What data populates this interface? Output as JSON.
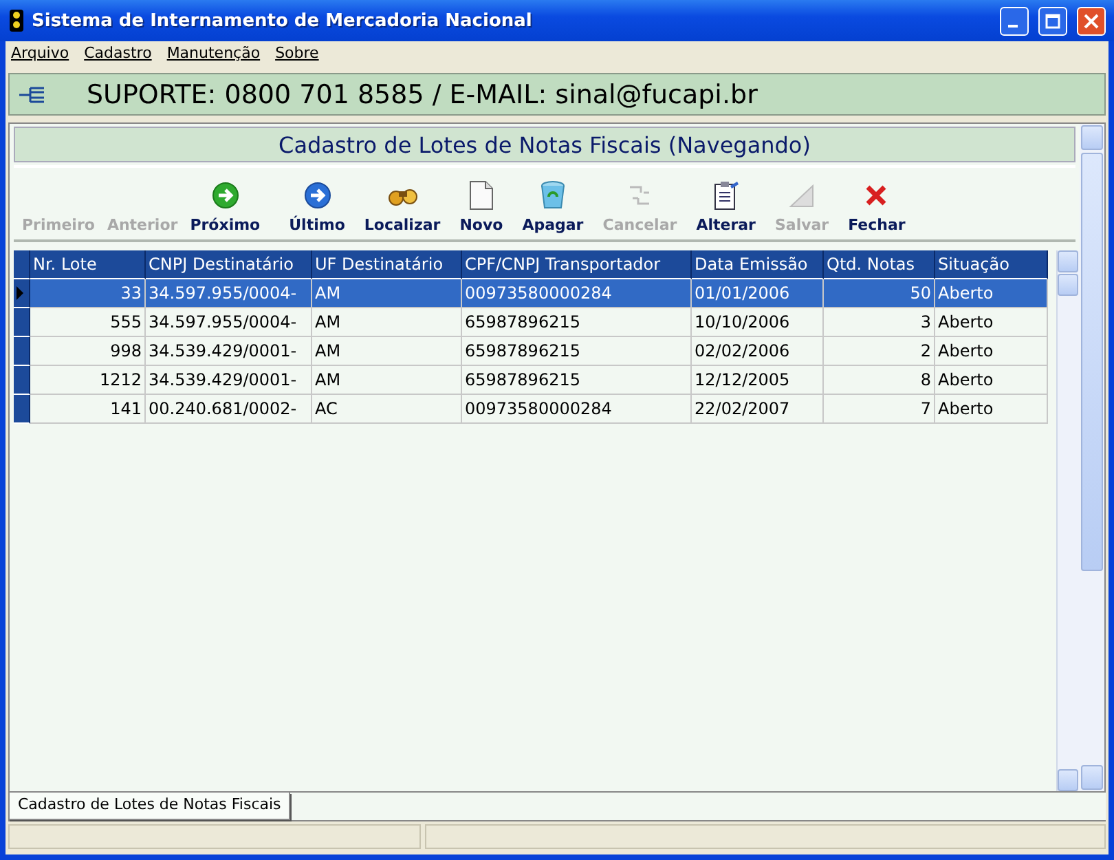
{
  "window": {
    "title": "Sistema de Internamento de Mercadoria Nacional"
  },
  "menu": [
    "Arquivo",
    "Cadastro",
    "Manutenção",
    "Sobre"
  ],
  "banner": "SUPORTE: 0800 701 8585 / E-MAIL: sinal@fucapi.br",
  "form_title": "Cadastro de Lotes de Notas Fiscais (Navegando)",
  "toolbar": [
    {
      "label": "Primeiro",
      "kind": "none",
      "disabled": true
    },
    {
      "label": "Anterior",
      "kind": "none",
      "disabled": true
    },
    {
      "label": "Próximo",
      "kind": "next",
      "disabled": false
    },
    {
      "label": "Último",
      "kind": "last",
      "disabled": false
    },
    {
      "label": "Localizar",
      "kind": "find",
      "disabled": false
    },
    {
      "label": "Novo",
      "kind": "new",
      "disabled": false
    },
    {
      "label": "Apagar",
      "kind": "delete",
      "disabled": false
    },
    {
      "label": "Cancelar",
      "kind": "cancel",
      "disabled": true
    },
    {
      "label": "Alterar",
      "kind": "edit",
      "disabled": false
    },
    {
      "label": "Salvar",
      "kind": "save",
      "disabled": true
    },
    {
      "label": "Fechar",
      "kind": "close",
      "disabled": false
    }
  ],
  "table": {
    "columns": [
      "Nr. Lote",
      "CNPJ Destinatário",
      "UF Destinatário",
      "CPF/CNPJ Transportador",
      "Data Emissão",
      "Qtd. Notas",
      "Situação"
    ],
    "rows": [
      {
        "cells": [
          "33",
          "34.597.955/0004-",
          "AM",
          "00973580000284",
          "01/01/2006",
          "50",
          "Aberto"
        ],
        "selected": true
      },
      {
        "cells": [
          "555",
          "34.597.955/0004-",
          "AM",
          "65987896215",
          "10/10/2006",
          "3",
          "Aberto"
        ],
        "selected": false
      },
      {
        "cells": [
          "998",
          "34.539.429/0001-",
          "AM",
          "65987896215",
          "02/02/2006",
          "2",
          "Aberto"
        ],
        "selected": false
      },
      {
        "cells": [
          "1212",
          "34.539.429/0001-",
          "AM",
          "65987896215",
          "12/12/2005",
          "8",
          "Aberto"
        ],
        "selected": false
      },
      {
        "cells": [
          "141",
          "00.240.681/0002-",
          "AC",
          "00973580000284",
          "22/02/2007",
          "7",
          "Aberto"
        ],
        "selected": false
      }
    ]
  },
  "tabs": [
    {
      "label": "Cadastro de Lotes de Notas Fiscais",
      "selected": true
    }
  ]
}
